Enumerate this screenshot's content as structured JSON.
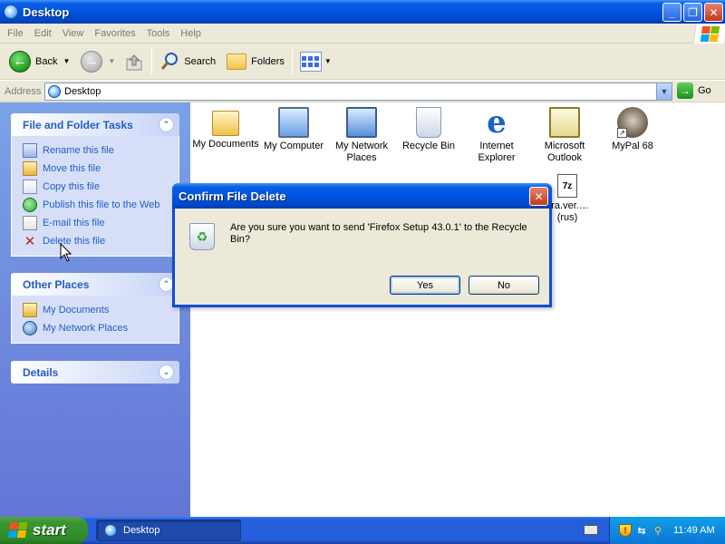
{
  "window": {
    "title": "Desktop"
  },
  "menu": [
    "File",
    "Edit",
    "View",
    "Favorites",
    "Tools",
    "Help"
  ],
  "toolbar": {
    "back_label": "Back",
    "search_label": "Search",
    "folders_label": "Folders"
  },
  "address": {
    "label": "Address",
    "value": "Desktop",
    "go_label": "Go"
  },
  "task_pane": {
    "file_tasks": {
      "title": "File and Folder Tasks",
      "items": [
        {
          "label": "Rename this file",
          "icon": "rename-icon"
        },
        {
          "label": "Move this file",
          "icon": "move-icon"
        },
        {
          "label": "Copy this file",
          "icon": "copy-icon"
        },
        {
          "label": "Publish this file to the Web",
          "icon": "publish-icon"
        },
        {
          "label": "E-mail this file",
          "icon": "email-icon"
        },
        {
          "label": "Delete this file",
          "icon": "delete-icon"
        }
      ]
    },
    "other_places": {
      "title": "Other Places",
      "items": [
        {
          "label": "My Documents",
          "icon": "my-documents-icon"
        },
        {
          "label": "My Network Places",
          "icon": "network-places-icon"
        }
      ]
    },
    "details": {
      "title": "Details"
    }
  },
  "desktop_icons": [
    {
      "label": "My Documents"
    },
    {
      "label": "My Computer"
    },
    {
      "label": "My Network Places"
    },
    {
      "label": "Recycle Bin"
    },
    {
      "label": "Internet Explorer"
    },
    {
      "label": "Microsoft Outlook"
    },
    {
      "label": "MyPal 68"
    },
    {
      "label": "era.ver.… (rus)",
      "icon_text": "7z"
    }
  ],
  "dialog": {
    "title": "Confirm File Delete",
    "message": "Are you sure you want to send 'Firefox Setup 43.0.1' to the Recycle Bin?",
    "yes_label": "Yes",
    "no_label": "No"
  },
  "taskbar": {
    "start_label": "start",
    "task_label": "Desktop",
    "clock": "11:49 AM"
  },
  "colors": {
    "title_blue": "#0054e3",
    "task_pane_link": "#215dc6",
    "start_green": "#3c9532"
  }
}
